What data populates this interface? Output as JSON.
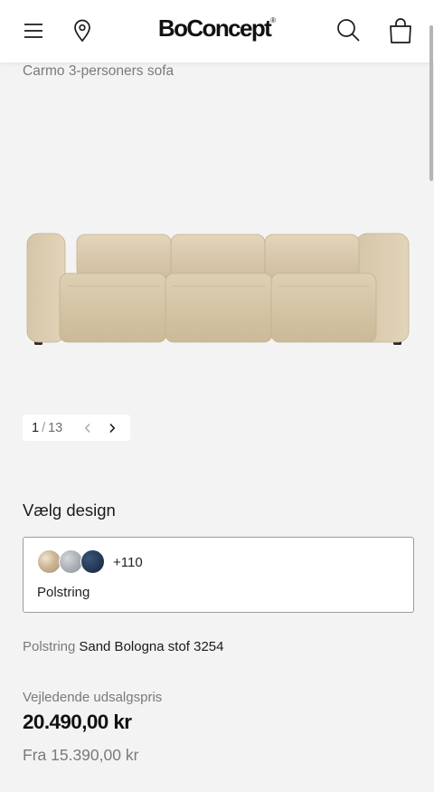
{
  "header": {
    "brand": "BoConcept",
    "brand_mark": "®",
    "icons": [
      "menu-icon",
      "location-pin-icon",
      "search-icon",
      "shopping-bag-icon"
    ]
  },
  "product": {
    "name": "Carmo 3-personers sofa",
    "image_color": "#d9c8ab"
  },
  "gallery": {
    "current": "1",
    "separator": "/",
    "total": "13"
  },
  "design": {
    "title": "Vælg design",
    "swatch_colors": [
      "#c9b392",
      "#a9adb4",
      "#243a58"
    ],
    "more_count": "+110",
    "label": "Polstring"
  },
  "upholstery": {
    "label": "Polstring",
    "value": "Sand Bologna stof 3254"
  },
  "pricing": {
    "label": "Vejledende udsalgspris",
    "price": "20.490,00 kr",
    "from": "Fra 15.390,00 kr"
  }
}
